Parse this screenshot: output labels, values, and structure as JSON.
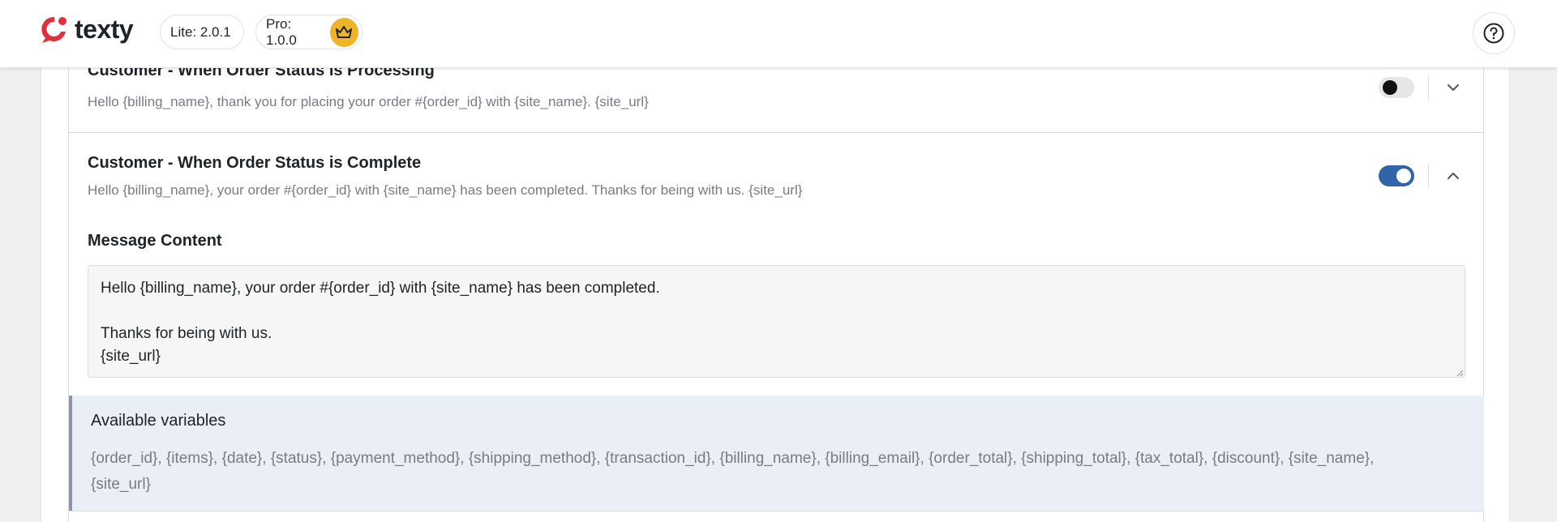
{
  "header": {
    "logo_text": "texty",
    "lite_version": "Lite: 2.0.1",
    "pro_version": "Pro: 1.0.0",
    "icons": {
      "logo": "texty-logo-icon",
      "crown": "crown-icon",
      "help": "question-circle-icon"
    },
    "colors": {
      "logo_red": "#e0303b",
      "crown_bg": "#f0b429"
    }
  },
  "rows": [
    {
      "title": "Customer - When Order Status is Processing",
      "description": "Hello {billing_name}, thank you for placing your order #{order_id} with {site_name}. {site_url}",
      "enabled": false,
      "expanded": false
    },
    {
      "title": "Customer - When Order Status is Complete",
      "description": "Hello {billing_name}, your order #{order_id} with {site_name} has been completed. Thanks for being with us. {site_url}",
      "enabled": true,
      "expanded": true
    }
  ],
  "message": {
    "label": "Message Content",
    "content": "Hello {billing_name}, your order #{order_id} with {site_name} has been completed.\n\nThanks for being with us.\n{site_url}"
  },
  "variables": {
    "title": "Available variables",
    "list": "{order_id}, {items}, {date}, {status}, {payment_method}, {shipping_method}, {transaction_id}, {billing_name}, {billing_email}, {order_total}, {shipping_total}, {tax_total}, {discount}, {site_name}, {site_url}"
  },
  "colors": {
    "toggle_on": "#2f64a8",
    "accent_bg": "#e9eef7"
  }
}
